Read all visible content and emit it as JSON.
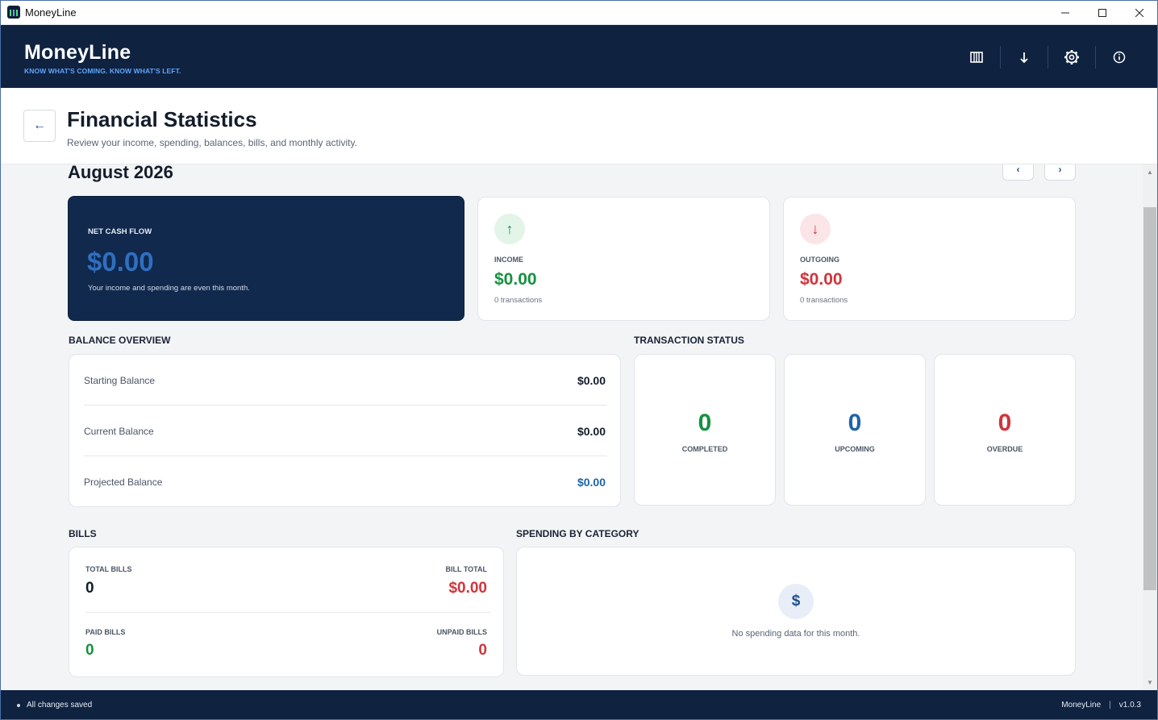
{
  "window": {
    "title": "MoneyLine",
    "minimize": "—",
    "maximize": "☐",
    "close": "✕"
  },
  "header": {
    "brand": "MoneyLine",
    "tagline": "KNOW WHAT'S COMING. KNOW WHAT'S LEFT."
  },
  "page": {
    "title": "Financial Statistics",
    "subtitle": "Review your income, spending, balances, bills, and monthly activity.",
    "back": "←"
  },
  "month": {
    "label": "August 2026",
    "prev": "‹",
    "next": "›"
  },
  "net_cash_flow": {
    "label": "NET CASH FLOW",
    "value": "$0.00",
    "note": "Your income and spending are even this month."
  },
  "income": {
    "label": "INCOME",
    "value": "$0.00",
    "note": "0 transactions",
    "icon": "↑"
  },
  "outgoing": {
    "label": "OUTGOING",
    "value": "$0.00",
    "note": "0 transactions",
    "icon": "↓"
  },
  "balance_overview": {
    "title": "BALANCE OVERVIEW",
    "rows": [
      {
        "label": "Starting Balance",
        "value": "$0.00"
      },
      {
        "label": "Current Balance",
        "value": "$0.00"
      },
      {
        "label": "Projected Balance",
        "value": "$0.00"
      }
    ]
  },
  "transaction_status": {
    "title": "TRANSACTION STATUS",
    "items": [
      {
        "label": "COMPLETED",
        "value": "0"
      },
      {
        "label": "UPCOMING",
        "value": "0"
      },
      {
        "label": "OVERDUE",
        "value": "0"
      }
    ]
  },
  "bills": {
    "title": "BILLS",
    "total_bills_label": "TOTAL BILLS",
    "total_bills": "0",
    "bill_total_label": "BILL TOTAL",
    "bill_total": "$0.00",
    "paid_label": "PAID BILLS",
    "paid": "0",
    "unpaid_label": "UNPAID BILLS",
    "unpaid": "0"
  },
  "spending_by_category": {
    "title": "SPENDING BY CATEGORY",
    "icon": "$",
    "empty": "No spending data for this month."
  },
  "status": {
    "saved": "All changes saved",
    "app": "MoneyLine",
    "sep": "|",
    "version": "v1.0.3"
  },
  "colors": {
    "navy": "#0f2240",
    "green": "#16913f",
    "red": "#d0343c",
    "blue": "#1e63aa"
  }
}
